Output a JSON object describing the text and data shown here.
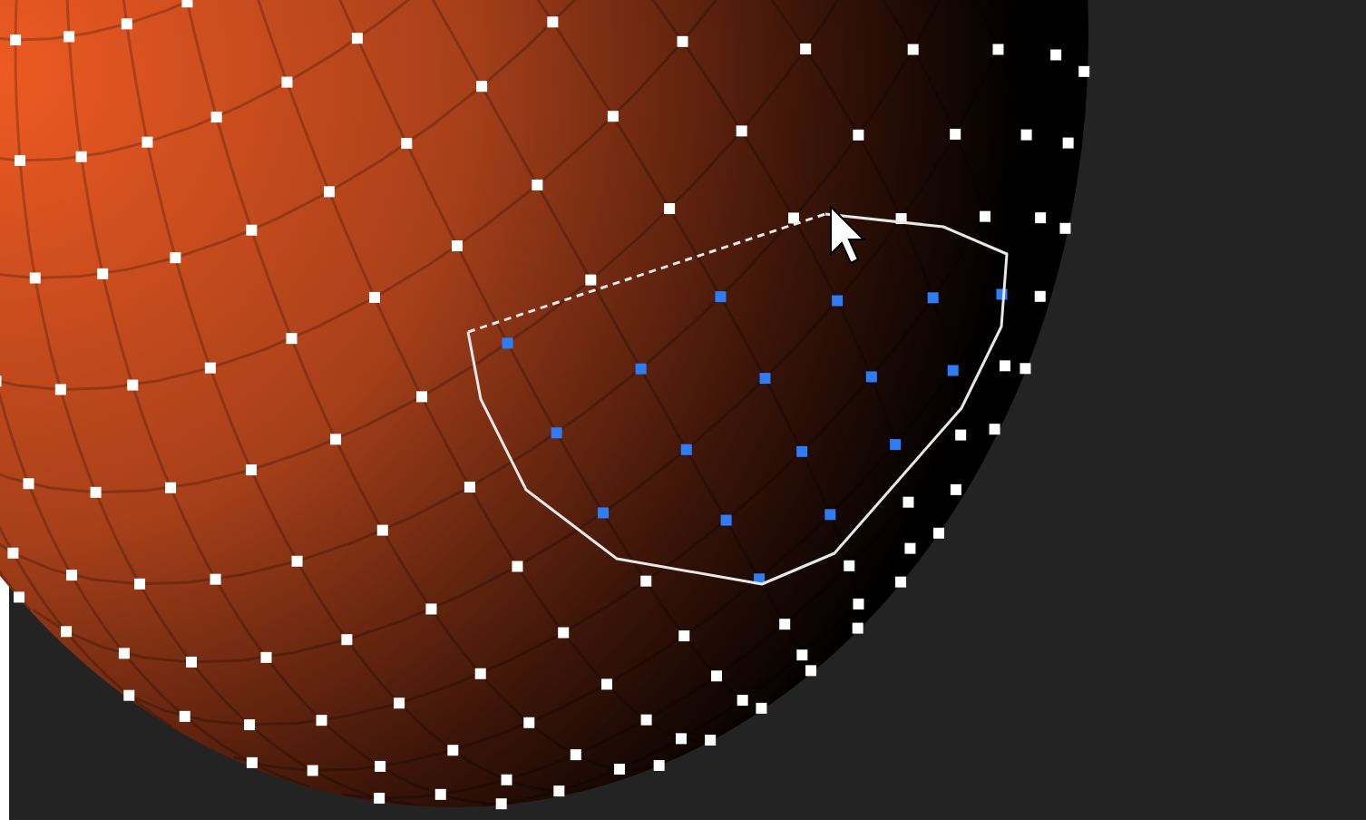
{
  "viewport": {
    "lasso_active": true,
    "cursor_shown": true
  }
}
